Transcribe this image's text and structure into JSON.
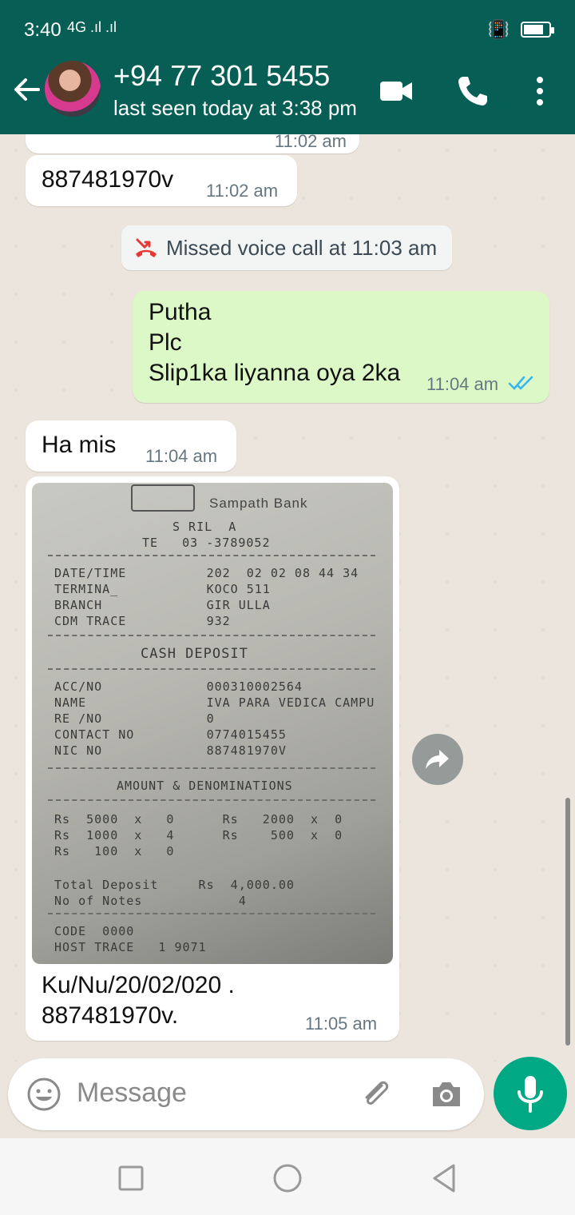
{
  "status_bar": {
    "time": "3:40",
    "signal": "4G .ıl .ıl"
  },
  "header": {
    "contact": "+94 77 301 5455",
    "last_seen": "last seen today at 3:38 pm",
    "icons": [
      "back-arrow-icon",
      "video-call-icon",
      "phone-icon",
      "more-vert-icon"
    ]
  },
  "messages": [
    {
      "id": "prev",
      "dir": "in",
      "time": "11:02 am"
    },
    {
      "id": "id_msg",
      "dir": "in",
      "text": "887481970v",
      "time": "11:02 am"
    },
    {
      "id": "missed",
      "type": "system",
      "text": "Missed voice call at 11:03 am"
    },
    {
      "id": "out",
      "dir": "out",
      "text": "Putha\nPlc\nSlip1ka liyanna oya 2ka",
      "time": "11:04 am",
      "read": true
    },
    {
      "id": "ha",
      "dir": "in",
      "text": "Ha mis",
      "time": "11:04 am"
    },
    {
      "id": "img",
      "dir": "in",
      "type": "image",
      "caption": "Ku/Nu/20/02/020 .\n887481970v.",
      "time": "11:05 am"
    }
  ],
  "receipt": {
    "bank": "Sampath Bank",
    "lines": [
      "S RIL  A",
      "TE   03 -3789052",
      "DATE/TIME          202  02 02 08 44 34",
      "TERMINA_           KOCO 511",
      "BRANCH             GIR ULLA",
      "CDM TRACE          932",
      "CASH DEPOSIT",
      "ACC/NO             000310002564",
      "NAME               IVA PARA VEDICA CAMPU",
      "RE /NO             0",
      "CONTACT NO         0774015455",
      "NIC NO             887481970V",
      "AMOUNT & DENOMINATIONS",
      "Rs  5000  x   0      Rs   2000  x  0",
      "Rs  1000  x   4      Rs    500  x  0",
      "Rs   100  x   0",
      "Total Deposit     Rs  4,000.00",
      "No of Notes            4",
      "CODE  0000",
      "HOST TRACE   1 9071"
    ]
  },
  "composer": {
    "placeholder": "Message"
  },
  "colors": {
    "header": "#075e54",
    "outgoing": "#dcf8c6",
    "accent": "#00a884",
    "ticks": "#34b7f1",
    "missed": "#e53935"
  }
}
